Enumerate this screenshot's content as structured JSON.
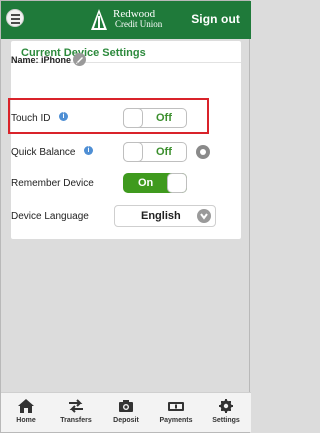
{
  "header": {
    "brand_name": "Redwood",
    "brand_sub": "Credit Union",
    "signout_label": "Sign out",
    "bg_color": "#1f7a3a"
  },
  "card": {
    "title": "Current Device Settings",
    "name_label": "Name: iPhone",
    "rows": {
      "touch_id": {
        "label": "Touch ID",
        "state": "Off"
      },
      "quick_balance": {
        "label": "Quick Balance",
        "state": "Off"
      },
      "remember_device": {
        "label": "Remember Device",
        "state": "On"
      },
      "device_language": {
        "label": "Device Language",
        "value": "English"
      }
    }
  },
  "icons": {
    "menu": "menu-icon",
    "pencil": "pencil-icon",
    "info": "info-icon",
    "gear": "gear-icon",
    "chevron": "chevron-down-icon"
  },
  "tabs": [
    {
      "label": "Home",
      "icon": "home-icon"
    },
    {
      "label": "Transfers",
      "icon": "transfer-arrows-icon"
    },
    {
      "label": "Deposit",
      "icon": "camera-icon"
    },
    {
      "label": "Payments",
      "icon": "payments-icon"
    },
    {
      "label": "Settings",
      "icon": "gear-icon"
    }
  ],
  "colors": {
    "accent_green": "#3f9a1e",
    "title_green": "#2c8a3c",
    "highlight_red": "#d9232a"
  }
}
